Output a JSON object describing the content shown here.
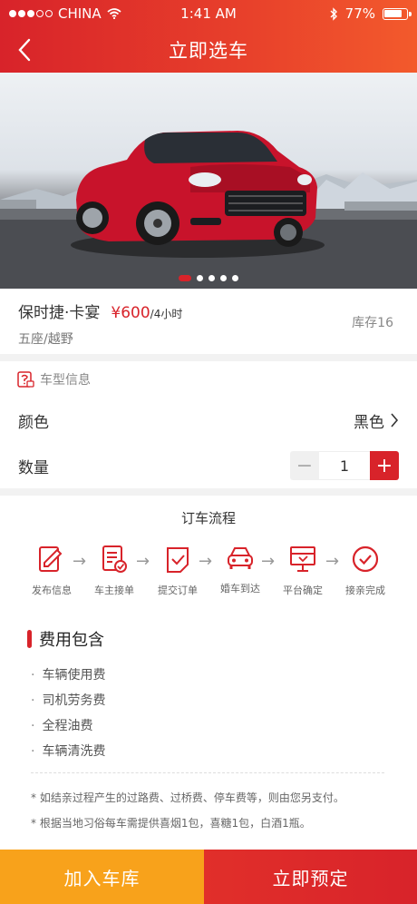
{
  "status_bar": {
    "carrier": "CHINA",
    "time": "1:41 AM",
    "battery": "77%"
  },
  "nav": {
    "title": "立即选车"
  },
  "hero": {
    "active_slide": 1,
    "slide_count": 5
  },
  "car": {
    "name": "保时捷·卡宴",
    "price": "¥600",
    "price_unit": "/4小时",
    "spec": "五座/越野",
    "stock": "库存16"
  },
  "model_info": {
    "section_title": "车型信息",
    "color_label": "颜色",
    "color_value": "黑色",
    "quantity_label": "数量",
    "quantity_value": "1",
    "minus": "−",
    "plus": "+"
  },
  "process": {
    "title": "订车流程",
    "steps": [
      {
        "label": "发布信息",
        "icon": "edit-doc-icon"
      },
      {
        "label": "车主接单",
        "icon": "doc-check-icon"
      },
      {
        "label": "提交订单",
        "icon": "order-check-icon"
      },
      {
        "label": "婚车到达",
        "icon": "car-icon"
      },
      {
        "label": "平台确定",
        "icon": "monitor-icon"
      },
      {
        "label": "接亲完成",
        "icon": "check-circle-icon"
      }
    ],
    "arrow": "→"
  },
  "fees": {
    "title": "费用包含",
    "items": [
      "车辆使用费",
      "司机劳务费",
      "全程油费",
      "车辆清洗费"
    ],
    "notes": [
      "* 如结亲过程产生的过路费、过桥费、停车费等，则由您另支付。",
      "* 根据当地习俗每车需提供喜烟1包，喜糖1包，白酒1瓶。"
    ]
  },
  "actions": {
    "add_to_garage": "加入车库",
    "book_now": "立即预定"
  },
  "colors": {
    "brand_red": "#d8232a",
    "orange": "#f8a21b"
  }
}
